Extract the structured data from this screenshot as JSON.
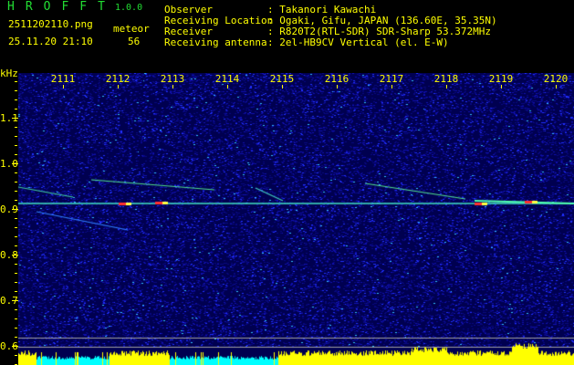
{
  "app": {
    "title": "HROFFT",
    "version": "1.0.0"
  },
  "file": {
    "name": "2511202110.png",
    "datetime": "25.11.20 21:10"
  },
  "meteor": {
    "label": "meteor",
    "count": "56"
  },
  "info": [
    {
      "key": "Observer",
      "value": ": Takanori Kawachi"
    },
    {
      "key": "Receiving Location",
      "value": ": Ogaki, Gifu, JAPAN (136.60E, 35.35N)"
    },
    {
      "key": "Receiver",
      "value": ": R820T2(RTL-SDR) SDR-Sharp 53.372MHz"
    },
    {
      "key": "Receiving antenna",
      "value": ": 2el-HB9CV Vertical (el. E-W)"
    }
  ],
  "axis": {
    "y_unit": "kHz",
    "y_labels": [
      "1.1",
      "1.0",
      "0.9",
      "0.8",
      "0.7",
      "0.6"
    ],
    "x_labels": [
      "2111",
      "2112",
      "2113",
      "2114",
      "2115",
      "2116",
      "2117",
      "2118",
      "2119",
      "2120"
    ]
  },
  "colors": {
    "text": "#ffff00",
    "title": "#22dd33",
    "background": "#000000",
    "noise": "#1010a0",
    "meter_active": "#ffff00",
    "meter_idle": "#00ffff"
  }
}
